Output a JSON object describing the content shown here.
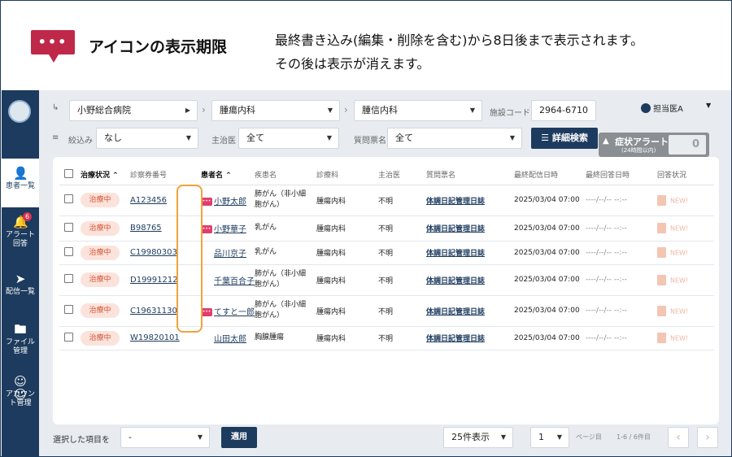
{
  "banner": {
    "title": "アイコンの表示期限",
    "desc_line1": "最終書き込み(編集・削除を含む)から8日後まで表示されます。",
    "desc_line2": "その後は表示が消えます。",
    "icon_symbol": "•••"
  },
  "sidebar": {
    "items": [
      {
        "label_l1": "患者一覧",
        "label_l2": "",
        "icon": "user-icon"
      },
      {
        "label_l1": "アラート",
        "label_l2": "回答",
        "icon": "bell-icon",
        "badge": "6"
      },
      {
        "label_l1": "配信一覧",
        "label_l2": "",
        "icon": "send-icon"
      },
      {
        "label_l1": "ファイル",
        "label_l2": "管理",
        "icon": "folder-icon"
      },
      {
        "label_l1": "アカウン",
        "label_l2": "ト管理",
        "icon": "users-icon"
      }
    ]
  },
  "filters": {
    "hospital": "小野総合病院",
    "dept1": "腫瘍内科",
    "dept2": "腫信内科",
    "facility_code_label": "施設コード",
    "facility_code": "2964-6710",
    "narrow_label": "絞込み",
    "narrow_value": "なし",
    "doctor_label": "主治医",
    "doctor_value": "全て",
    "questionnaire_label": "質問票名",
    "questionnaire_value": "全て",
    "detail_search": "詳細検索"
  },
  "user": {
    "name": "担当医A"
  },
  "alert": {
    "title": "症状アラート",
    "sub": "(24時間以内)",
    "count": "0"
  },
  "table": {
    "headers": {
      "status": "治療状況",
      "card_no": "診察券番号",
      "patient": "患者名",
      "disease": "疾患名",
      "dept": "診療科",
      "doctor": "主治医",
      "questionnaire": "質問票名",
      "last_sent": "最終配信日時",
      "last_answer": "最終回答日時",
      "answer_status": "回答状況"
    },
    "rows": [
      {
        "status": "治療中",
        "card_no": "A123456",
        "msg": true,
        "patient": "小野太郎",
        "disease_l1": "肺がん（非小細",
        "disease_l2": "胞がん）",
        "dept": "腫瘍内科",
        "doctor": "不明",
        "questionnaire": "体調日記管理日誌",
        "last_sent": "2025/03/04 07:00",
        "last_answer": "----/--/-- --:--",
        "answer": "NEW!"
      },
      {
        "status": "治療中",
        "card_no": "B98765",
        "msg": true,
        "patient": "小野華子",
        "disease_l1": "乳がん",
        "disease_l2": "",
        "dept": "腫瘍内科",
        "doctor": "不明",
        "questionnaire": "体調日記管理日誌",
        "last_sent": "2025/03/04 07:00",
        "last_answer": "----/--/-- --:--",
        "answer": "NEW!"
      },
      {
        "status": "治療中",
        "card_no": "C19980303",
        "msg": false,
        "patient": "品川京子",
        "disease_l1": "乳がん",
        "disease_l2": "",
        "dept": "腫瘍内科",
        "doctor": "不明",
        "questionnaire": "体調日記管理日誌",
        "last_sent": "2025/03/04 07:00",
        "last_answer": "----/--/-- --:--",
        "answer": "NEW!"
      },
      {
        "status": "治療中",
        "card_no": "D19991212",
        "msg": false,
        "patient": "千葉百合子",
        "disease_l1": "肺がん（非小細",
        "disease_l2": "胞がん）",
        "dept": "腫瘍内科",
        "doctor": "不明",
        "questionnaire": "体調日記管理日誌",
        "last_sent": "2025/03/04 07:00",
        "last_answer": "----/--/-- --:--",
        "answer": "NEW!"
      },
      {
        "status": "治療中",
        "card_no": "C19631130",
        "msg": true,
        "patient": "てすと一郎",
        "disease_l1": "肺がん（非小細",
        "disease_l2": "胞がん）",
        "dept": "腫瘍内科",
        "doctor": "不明",
        "questionnaire": "体調日記管理日誌",
        "last_sent": "2025/03/04 07:00",
        "last_answer": "----/--/-- --:--",
        "answer": "NEW!"
      },
      {
        "status": "治療中",
        "card_no": "W19820101",
        "msg": false,
        "patient": "山田太郎",
        "disease_l1": "胸腺腫瘍",
        "disease_l2": "",
        "dept": "腫瘍内科",
        "doctor": "不明",
        "questionnaire": "体調日記管理日誌",
        "last_sent": "2025/03/04 07:00",
        "last_answer": "----/--/-- --:--",
        "answer": "NEW!"
      }
    ]
  },
  "bottom": {
    "selected_label": "選択した項目を",
    "action_value": "-",
    "apply": "適用",
    "per_page": "25件表示",
    "page": "1",
    "page_label": "ページ目",
    "range": "1-6 / 6件目",
    "prev": "‹",
    "next": "›"
  },
  "colors": {
    "navy": "#1d3b5e",
    "accent": "#c0284a",
    "highlight": "#f0a23c",
    "status_bg": "#fbe3dc"
  }
}
